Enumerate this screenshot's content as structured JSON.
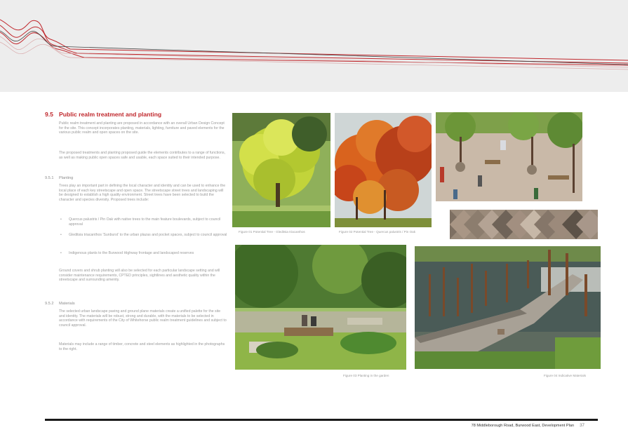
{
  "section": {
    "number": "9.5",
    "title": "Public realm treatment and planting",
    "intro_p1": "Public realm treatment and planting are proposed in accordance with an overall Urban Design Concept for the site. This concept incorporates planting, materials, lighting, furniture and paved elements for the various public realm and open spaces on the site.",
    "intro_p2": "The proposed treatments and planting proposed guide the elements contributes to a range of functions, as well as making public open spaces safe and usable, each space suited to their intended purpose."
  },
  "planting": {
    "number": "9.5.1",
    "title": "Planting",
    "p1": "Trees play an important part in defining the local character and identity and can be used to enhance the local place of each key streetscape and open space. The streetscape street trees and landscaping will be designed to establish a high quality environment. Street trees have been selected to build the character and species diversity. Proposed trees include:",
    "bullets": [
      "Quercus palustris / Pin Oak with native trees to the main feature boulevards, subject to council approval",
      "Gleditsia triacanthos 'Sunburst' to the urban plazas and pocket spaces, subject to council approval",
      "Indigenous plants to the Burwood Highway frontage and landscaped reserves"
    ],
    "p2": "Ground covers and shrub planting will also be selected for each particular landscape setting and will consider maintenance requirements, CPTED principles, sightlines and aesthetic quality within the streetscape and surrounding amenity."
  },
  "materials": {
    "number": "9.5.2",
    "title": "Materials",
    "p1": "The selected urban landscape paving and ground plane materials create a unified palette for the site and identity. The materials will be robust, strong and durable, with the materials to be selected in accordance with requirements of the City of Whitehorse public realm treatment guidelines and subject to council approval.",
    "p2": "Materials may include a range of timber, concrete and steel elements as highlighted in the photographs to the right."
  },
  "captions": {
    "fig1": "Figure 01 Potential Tree - Gleditsia triacanthos",
    "fig2": "Figure 02 Potential Tree - Quercus palustris / Pin Oak",
    "fig3": "Figure 03 Planting in the garden",
    "fig4": "Figure 04 Indicative Materials"
  },
  "footer": {
    "text": "78 Middleborough Road, Burwood East, Development Plan",
    "page": "37"
  },
  "colors": {
    "accent": "#c0282d",
    "header_band": "#ededed",
    "footer_rule": "#1a1a1a"
  }
}
